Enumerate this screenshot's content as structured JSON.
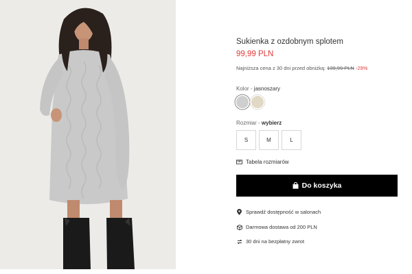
{
  "product": {
    "title": "Sukienka z ozdobnym splotem",
    "price": "99,99 PLN",
    "lowest_price_label": "Najniższa cena z 30 dni przed obniżką:",
    "old_price": "139,99 PLN",
    "discount": "-29%"
  },
  "color": {
    "label": "Kolor",
    "separator": " - ",
    "selected": "jasnoszary",
    "swatches": [
      {
        "name": "jasnoszary",
        "hex": "#cfcfcf"
      },
      {
        "name": "beige",
        "hex": "#e1d8c6"
      }
    ]
  },
  "size": {
    "label": "Rozmiar",
    "separator": " - ",
    "selected": "wybierz",
    "options": [
      "S",
      "M",
      "L"
    ]
  },
  "size_chart_label": "Tabela rozmiarów",
  "cart_button_label": "Do koszyka",
  "features": [
    {
      "icon": "location-pin-icon",
      "text": "Sprawdź dostępność w salonach"
    },
    {
      "icon": "box-icon",
      "text": "Darmowa dostawa od 200 PLN"
    },
    {
      "icon": "return-arrows-icon",
      "text": "30 dni na bezpłatny zwrot"
    }
  ],
  "colors": {
    "price_red": "#e03a3a",
    "button_black": "#000000"
  }
}
